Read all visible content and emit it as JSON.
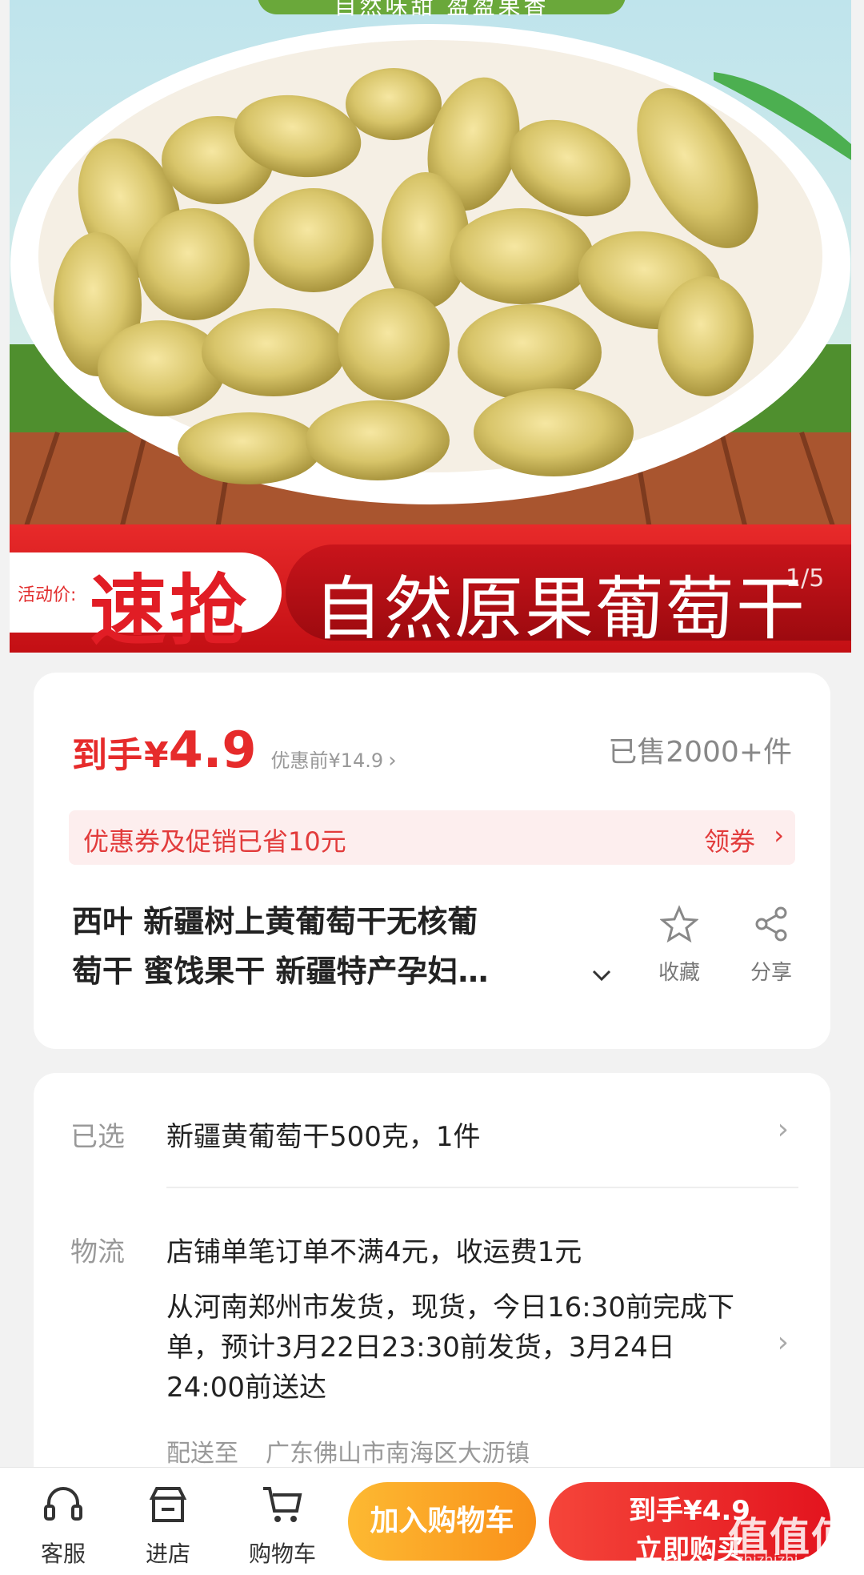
{
  "hero": {
    "top_tag": "自然味甜 盈盈果香",
    "price_label": "活动价:",
    "rush_label": "速抢",
    "banner_title": "自然原果葡萄干",
    "page_indicator": "1/5"
  },
  "price": {
    "prefix": "到手",
    "currency": "¥",
    "amount": "4.9",
    "before": "优惠前¥14.9",
    "sold": "已售2000+件"
  },
  "coupon": {
    "text": "优惠券及促销已省10元",
    "action": "领券"
  },
  "product": {
    "title_line1": "西叶  新疆树上黄葡萄干无核葡",
    "title_line2": "萄干 蜜饯果干 新疆特产孕妇…",
    "favorite_label": "收藏",
    "share_label": "分享"
  },
  "selection": {
    "label": "已选",
    "value": "新疆黄葡萄干500克，1件"
  },
  "logistics": {
    "label": "物流",
    "fee_text": "店铺单笔订单不满4元，收运费1元",
    "detail": "从河南郑州市发货，现货，今日16:30前完成下单，预计3月22日23:30前发货，3月24日24:00前送达",
    "ship_to_label": "配送至",
    "ship_to_value": "广东佛山市南海区大沥镇"
  },
  "bottom_bar": {
    "service_label": "客服",
    "store_label": "进店",
    "cart_label": "购物车",
    "add_cart_button": "加入购物车",
    "buy_line1": "到手¥4.9",
    "buy_line2": "立即购买"
  },
  "watermark": {
    "text": "值值值",
    "url": "zhizhizhi.com"
  },
  "colors": {
    "accent_red": "#e62b2b",
    "orange": "#f9911a",
    "banner_red": "#c30f14"
  }
}
